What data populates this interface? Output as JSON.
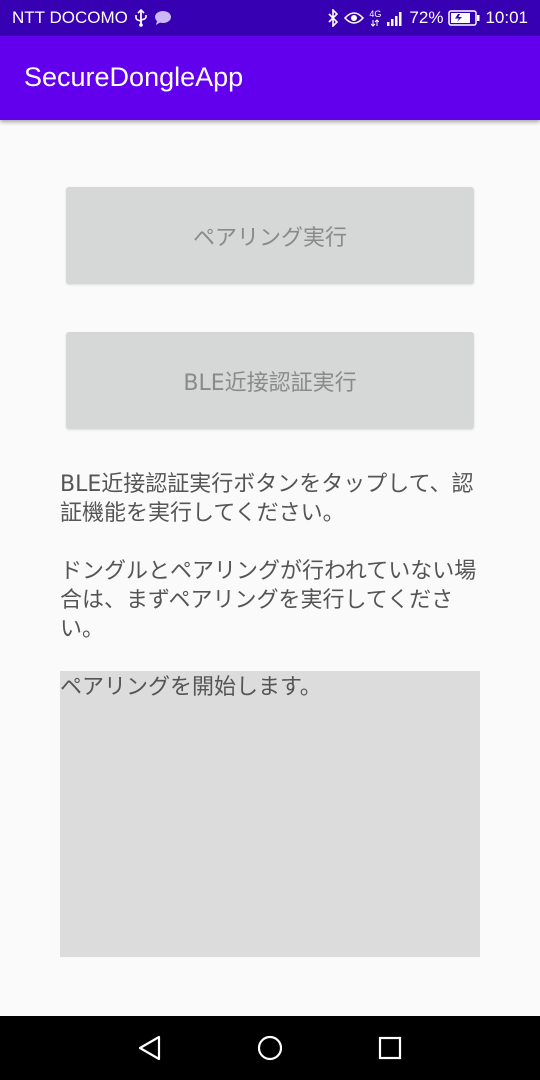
{
  "status_bar": {
    "carrier": "NTT DOCOMO",
    "network": "4G",
    "battery": "72%",
    "time": "10:01",
    "left_icons": [
      "usb-icon",
      "chat-bubble-icon"
    ],
    "right_icons": [
      "bluetooth-icon",
      "eye-icon",
      "network-4g-icon",
      "signal-icon",
      "battery-icon"
    ]
  },
  "app_bar": {
    "title": "SecureDongleApp"
  },
  "buttons": {
    "pairing_label": "ペアリング実行",
    "ble_label": "BLE近接認証実行"
  },
  "instructions": {
    "paragraph1": "BLE近接認証実行ボタンをタップして、認証機能を実行してください。",
    "paragraph2": "ドングルとペアリングが行われていない場合は、まずペアリングを実行してください。"
  },
  "log": {
    "text": "ペアリングを開始します。"
  },
  "nav_bar": {
    "buttons": [
      "back-icon",
      "home-icon",
      "recent-apps-icon"
    ]
  },
  "colors": {
    "status_bar": "#3700b3",
    "app_bar": "#6200ee",
    "background": "#fafafa",
    "button_bg": "#d6d7d7",
    "button_text": "#8a8a8a",
    "body_text": "#555555",
    "log_bg": "#dcdcdc",
    "nav_bar": "#000000"
  }
}
